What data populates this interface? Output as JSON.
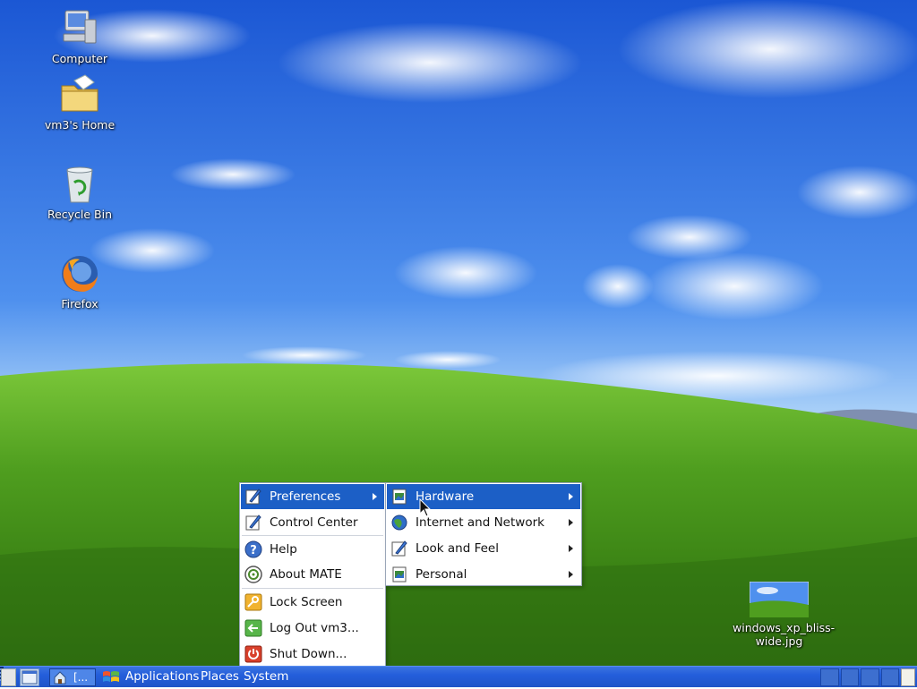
{
  "desktop": {
    "icons": [
      {
        "name": "Computer"
      },
      {
        "name": "vm3's Home"
      },
      {
        "name": "Recycle Bin"
      },
      {
        "name": "Firefox"
      }
    ],
    "file": {
      "name": "windows_xp_bliss-wide.jpg",
      "line1": "windows_xp_bliss-",
      "line2": "wide.jpg"
    }
  },
  "taskbar": {
    "task_label": "[...",
    "menus": {
      "applications": "Applications",
      "places": "Places",
      "system": "System"
    }
  },
  "system_menu": {
    "items": [
      {
        "label": "Preferences",
        "icon": "preferences-icon",
        "has_submenu": true,
        "active": true
      },
      {
        "label": "Control Center",
        "icon": "control-center-icon"
      },
      {
        "label": "Help",
        "icon": "help-icon"
      },
      {
        "label": "About MATE",
        "icon": "about-mate-icon"
      },
      {
        "label": "Lock Screen",
        "icon": "lock-icon"
      },
      {
        "label": "Log Out vm3...",
        "icon": "logout-icon"
      },
      {
        "label": "Shut Down...",
        "icon": "shutdown-icon"
      }
    ]
  },
  "preferences_submenu": {
    "items": [
      {
        "label": "Hardware",
        "icon": "hardware-icon",
        "has_submenu": true,
        "active": true
      },
      {
        "label": "Internet and Network",
        "icon": "network-icon",
        "has_submenu": true
      },
      {
        "label": "Look and Feel",
        "icon": "look-and-feel-icon",
        "has_submenu": true
      },
      {
        "label": "Personal",
        "icon": "personal-icon",
        "has_submenu": true
      }
    ]
  },
  "colors": {
    "menu_highlight": "#1c5fc6",
    "taskbar": "#245edb",
    "sky": "#3a7ee8",
    "grass": "#4c9a1e"
  }
}
